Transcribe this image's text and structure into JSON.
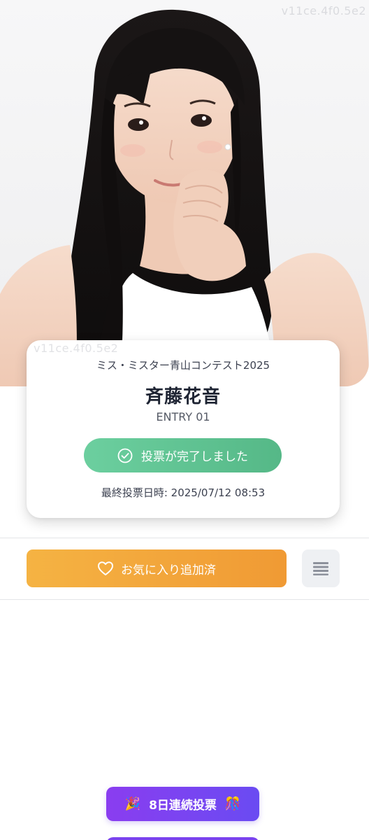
{
  "watermark": "v11ce.4f0.5e2",
  "contestant": {
    "contest_name": "ミス・ミスター青山コンテスト2025",
    "name": "斉藤花音",
    "entry_label": "ENTRY 01"
  },
  "vote_status": {
    "label": "投票が完了しました",
    "icon": "check-circle-icon",
    "color": "#5cc090"
  },
  "last_vote": {
    "text": "最終投票日時: 2025/07/12 08:53"
  },
  "actions": {
    "favorite_label": "お気に入り追加済",
    "favorite_icon": "heart-outline-icon",
    "favorite_color": "#f2a63a",
    "menu_icon": "menu-icon"
  },
  "streak": {
    "label": "8日連続投票",
    "emoji_left": "🎉",
    "emoji_right": "🎊",
    "color": "#7b42ef"
  }
}
